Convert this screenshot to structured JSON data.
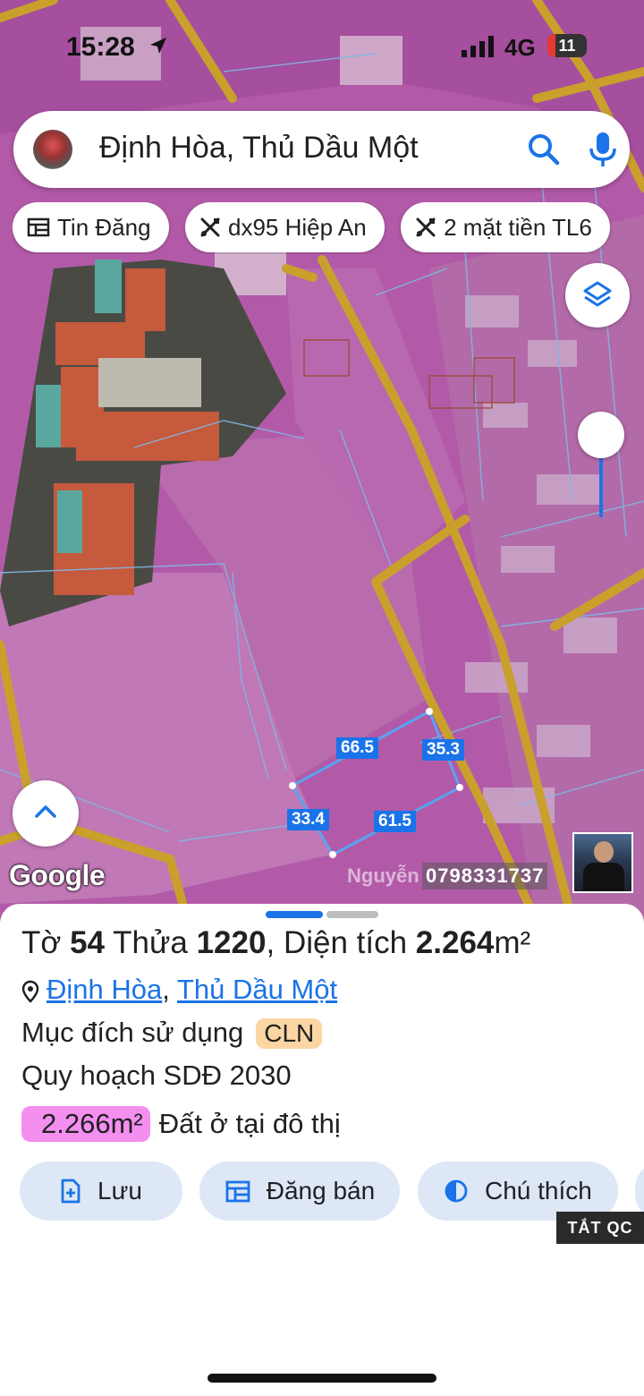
{
  "status_bar": {
    "time": "15:28",
    "network": "4G",
    "battery": "11"
  },
  "search": {
    "query": "Định Hòa, Thủ Dầu Một"
  },
  "chips": [
    {
      "label": "Tin Đăng",
      "icon": "listing-icon"
    },
    {
      "label": "dx95 Hiệp An",
      "icon": "tools-icon"
    },
    {
      "label": "2 mặt tiền TL6",
      "icon": "tools-icon"
    }
  ],
  "map": {
    "google_label": "Google",
    "watermark": "Nguyễn",
    "phone": "0798331737",
    "plot_edges": [
      "66.5",
      "35.3",
      "33.4",
      "61.5"
    ],
    "colors": {
      "overlay": "#b25aa8",
      "road": "#c9a02c",
      "boundary": "#7fb8e6",
      "edge_label": "#1a73e8"
    }
  },
  "parcel": {
    "to_label": "Tờ",
    "to_value": "54",
    "thua_label": "Thửa",
    "thua_value": "1220",
    "area_label": "Diện tích",
    "area_value": "2.264",
    "area_unit": "m²",
    "ward": "Định Hòa",
    "city": "Thủ Dầu Một",
    "purpose_label": "Mục đích sử dụng",
    "purpose_code": "CLN",
    "planning_label": "Quy hoạch SDĐ 2030",
    "planning_area": "2.266m²",
    "planning_type": "Đất ở tại đô thị"
  },
  "actions": [
    {
      "label": "Lưu",
      "icon": "save-icon"
    },
    {
      "label": "Đăng bán",
      "icon": "post-sale-icon"
    },
    {
      "label": "Chú thích",
      "icon": "legend-icon"
    }
  ],
  "ad_toggle": "TẮT QC"
}
